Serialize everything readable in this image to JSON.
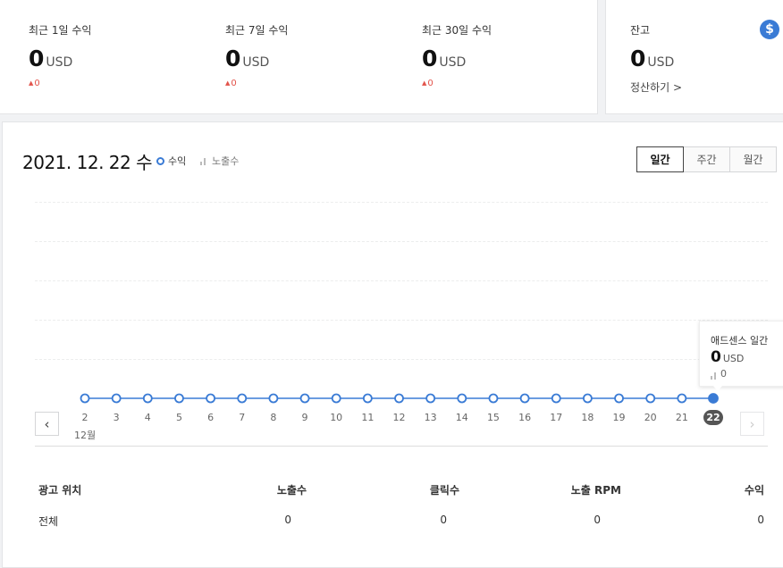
{
  "summary": {
    "stats": [
      {
        "label": "최근 1일 수익",
        "value": "0",
        "unit": "USD",
        "delta_marker": "▲",
        "delta": "0"
      },
      {
        "label": "최근 7일 수익",
        "value": "0",
        "unit": "USD",
        "delta_marker": "▲",
        "delta": "0"
      },
      {
        "label": "최근 30일 수익",
        "value": "0",
        "unit": "USD",
        "delta_marker": "▲",
        "delta": "0"
      }
    ]
  },
  "balance": {
    "label": "잔고",
    "value": "0",
    "unit": "USD",
    "link_label": "정산하기 >",
    "icon": "dollar-icon",
    "icon_glyph": "$"
  },
  "chart_header": {
    "date": "2021. 12. 22 수",
    "legend_revenue": "수익",
    "legend_impressions": "노출수",
    "period_tabs": [
      "일간",
      "주간",
      "월간"
    ],
    "active_tab": "일간"
  },
  "chart_data": {
    "type": "line",
    "x": [
      "2",
      "3",
      "4",
      "5",
      "6",
      "7",
      "8",
      "9",
      "10",
      "11",
      "12",
      "13",
      "14",
      "15",
      "16",
      "17",
      "18",
      "19",
      "20",
      "21",
      "22"
    ],
    "x_month_label": "12월",
    "series": [
      {
        "name": "수익",
        "values": [
          0,
          0,
          0,
          0,
          0,
          0,
          0,
          0,
          0,
          0,
          0,
          0,
          0,
          0,
          0,
          0,
          0,
          0,
          0,
          0,
          0
        ]
      }
    ],
    "selected_x": "22",
    "line_color": "#3a7bd5",
    "grid": true
  },
  "nav": {
    "prev_glyph": "‹",
    "next_glyph": "›"
  },
  "tooltip": {
    "title": "애드센스 일간",
    "value": "0",
    "unit": "USD",
    "impressions": "0"
  },
  "table": {
    "headers": [
      "광고 위치",
      "노출수",
      "클릭수",
      "노출 RPM",
      "수익"
    ],
    "rows": [
      [
        "전체",
        "0",
        "0",
        "0",
        "0"
      ]
    ]
  },
  "colors": {
    "accent": "#3a7bd5",
    "negative": "#e2534a"
  }
}
